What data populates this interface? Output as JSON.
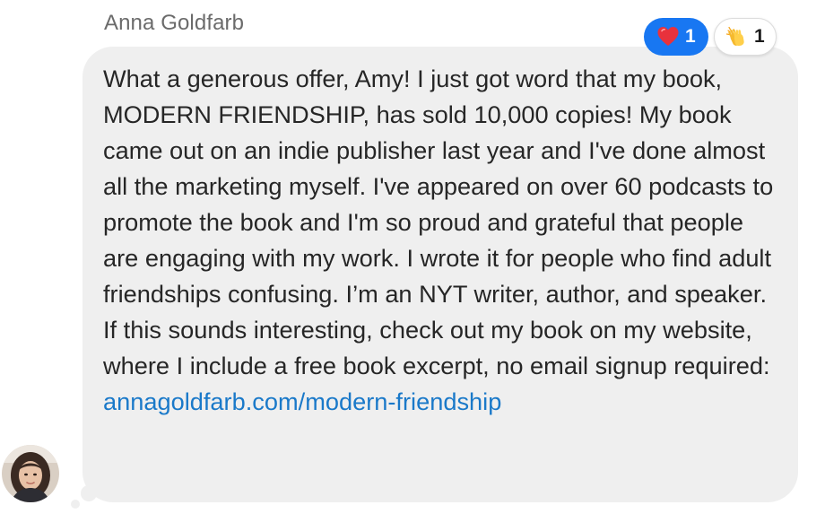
{
  "sender": {
    "name": "Anna Goldfarb"
  },
  "message": {
    "text": "What a generous offer, Amy! I just got word that my book, MODERN FRIENDSHIP, has sold 10,000 copies! My book came out on an indie publisher last year and I've done almost all the marketing myself. I've appeared on over 60 podcasts to promote the book and I'm so proud and grateful that people are engaging with my work. I wrote it for people who find adult friendships confusing. I’m an NYT writer, author, and speaker. If this sounds interesting, check out my book on my website, where I include a free book excerpt, no email signup required:",
    "link_text": "annagoldfarb.com/modern-friendship"
  },
  "reactions": [
    {
      "icon": "heart-icon",
      "count": "1",
      "bg_color": "#1877f2"
    },
    {
      "icon": "clapping-hands-icon",
      "count": "1",
      "bg_color": "#ffffff"
    }
  ],
  "colors": {
    "bubble": "#efefef",
    "link": "#1a79c9",
    "text": "#262626",
    "sender_name": "#6b6b6b"
  }
}
